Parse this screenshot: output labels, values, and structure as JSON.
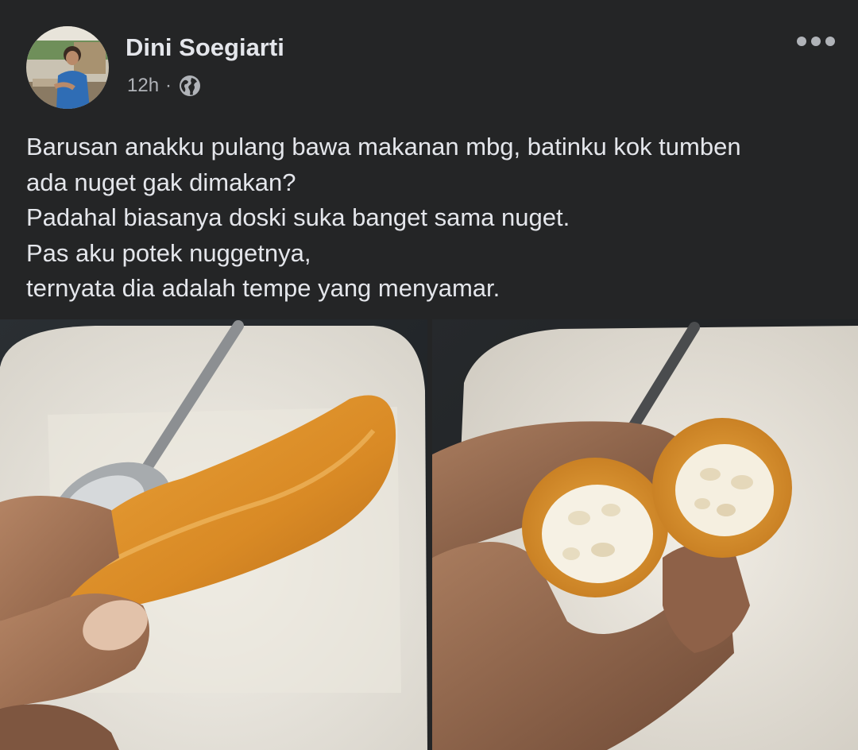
{
  "post": {
    "author_name": "Dini Soegiarti",
    "timestamp": "12h",
    "separator": "·",
    "privacy_icon": "globe-icon",
    "more_icon": "more-horizontal-icon",
    "text_lines": [
      "Barusan anakku pulang bawa makanan mbg, batinku kok tumben",
      "ada nuget gak dimakan?",
      "Padahal biasanya doski suka banget sama nuget.",
      "Pas aku potek nuggetnya,",
      "ternyata dia adalah tempe yang menyamar."
    ]
  },
  "colors": {
    "background": "#242526",
    "primary_text": "#e4e6eb",
    "secondary_text": "#b0b3b8"
  }
}
